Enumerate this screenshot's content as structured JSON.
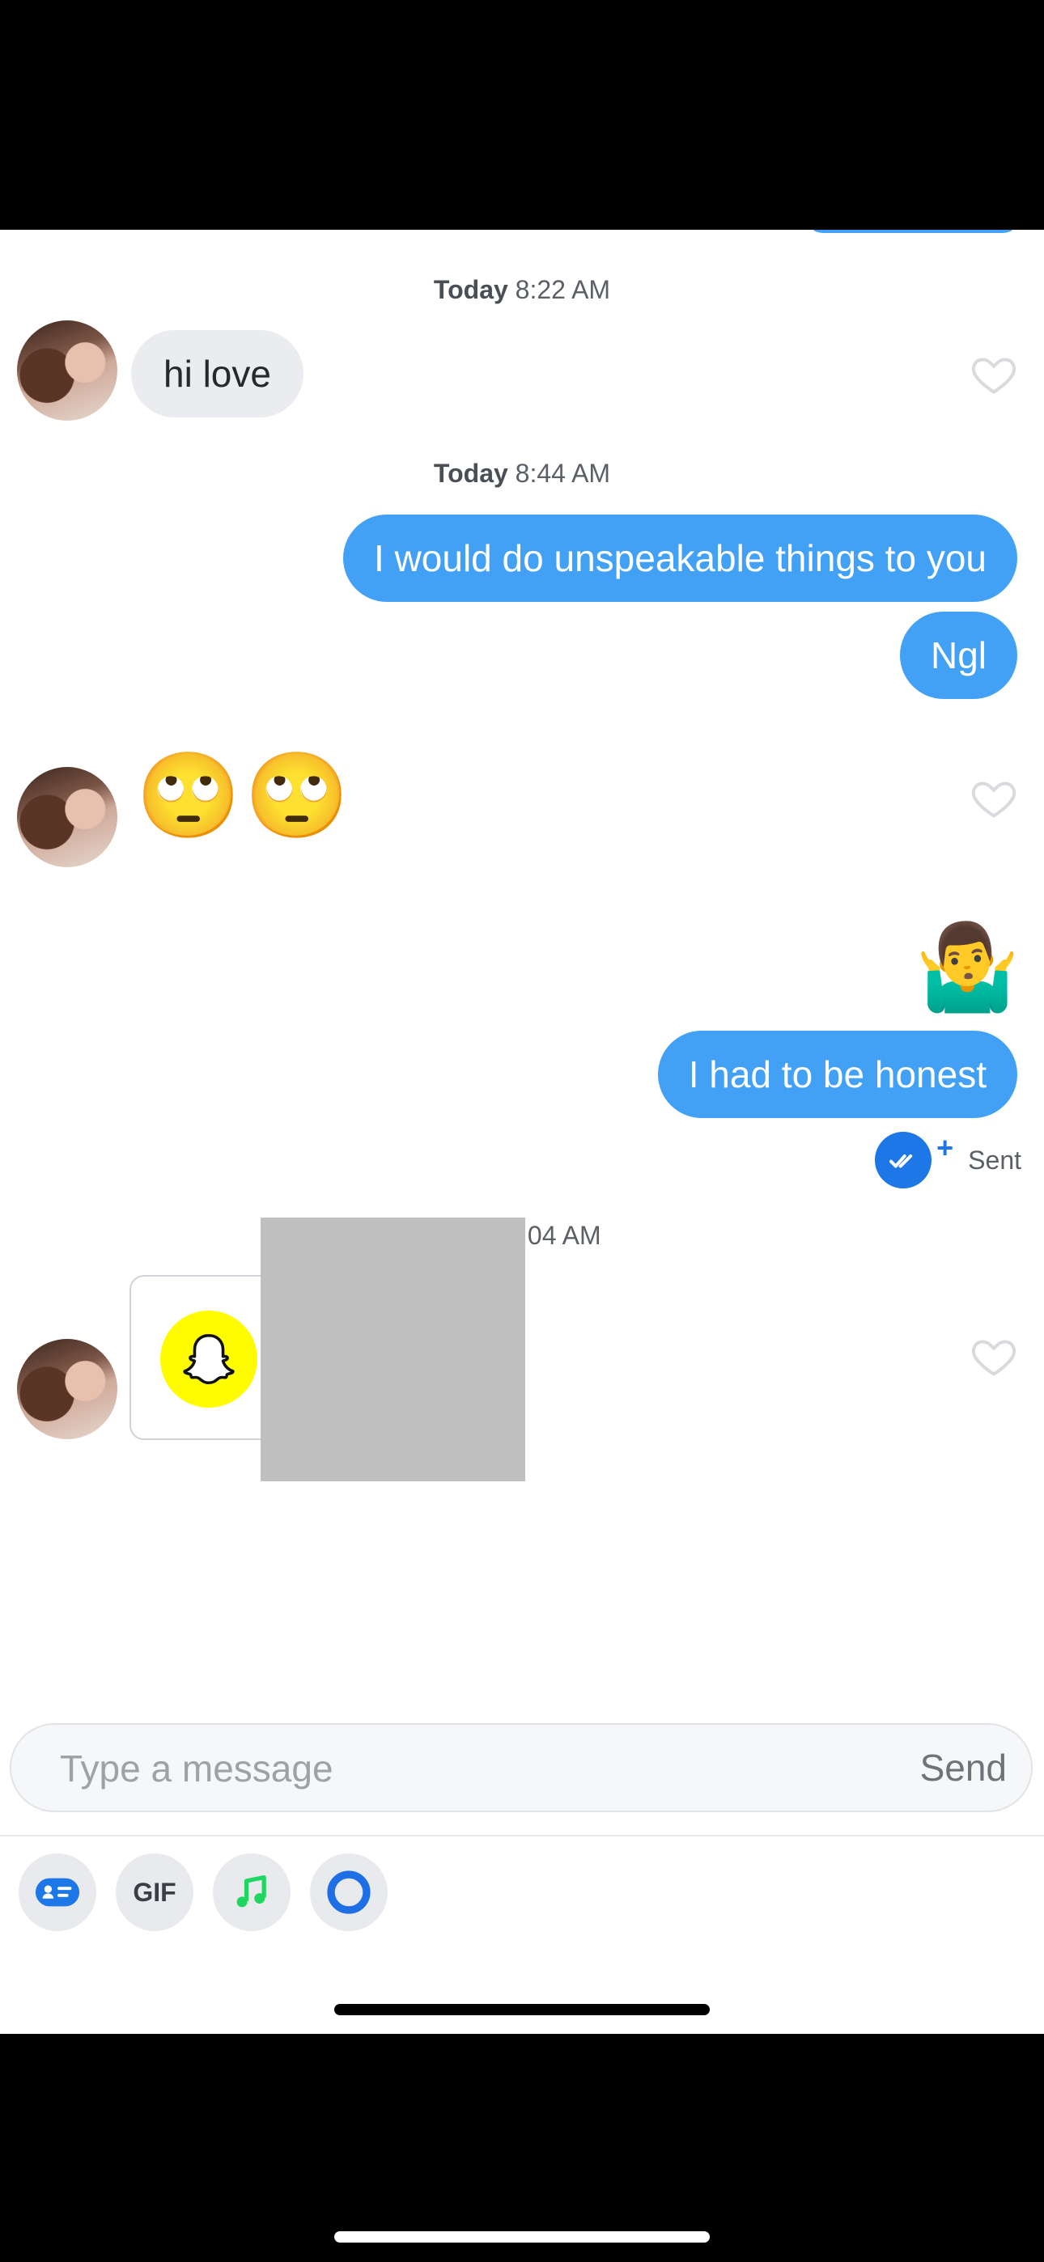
{
  "messages": {
    "ts1": {
      "day": "Today",
      "time": "8:22 AM"
    },
    "in1": "hi love",
    "ts2": {
      "day": "Today",
      "time": "8:44 AM"
    },
    "out1": "I would do unspeakable things to you",
    "out2": "Ngl",
    "in2_emoji": [
      "🙄",
      "🙄"
    ],
    "out3_emoji": "🤷‍♂️",
    "out4": "I had to be honest",
    "status": "Sent",
    "ts3_partial": ":04 AM"
  },
  "composer": {
    "placeholder": "Type a message",
    "send_label": "Send"
  },
  "tools": {
    "gif_label": "GIF"
  },
  "colors": {
    "outgoing_bubble": "#42a1f5",
    "incoming_bubble": "#ebecef",
    "accent": "#1e77e6",
    "snapchat": "#fffc00"
  }
}
